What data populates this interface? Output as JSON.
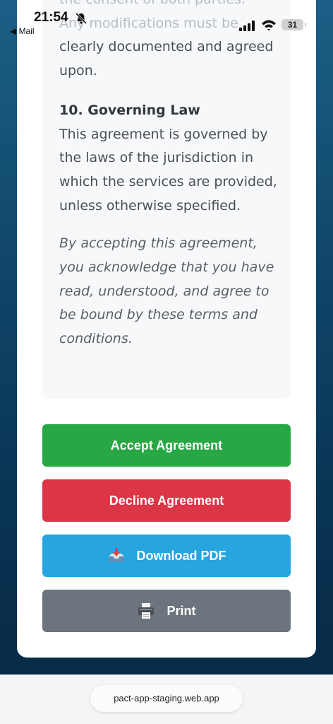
{
  "status_bar": {
    "time": "21:54",
    "back_app": "◀ Mail",
    "battery": "31"
  },
  "terms": {
    "faded_line_1": "the consent of both parties.",
    "faded_line_2": "Any modifications must be",
    "continued_text": "clearly documented and agreed upon.",
    "section_10_title": "10. Governing Law",
    "section_10_body": "This agreement is governed by the laws of the jurisdiction in which the services are provided, unless otherwise specified.",
    "closing_statement": "By accepting this agreement, you acknowledge that you have read, understood, and agree to be bound by these terms and conditions."
  },
  "buttons": {
    "accept": "Accept Agreement",
    "decline": "Decline Agreement",
    "download": "Download PDF",
    "print": "Print"
  },
  "icons": {
    "bell": "bell-slash-icon",
    "signal": "cellular-signal-icon",
    "wifi": "wifi-icon",
    "download": "inbox-tray-icon",
    "print": "printer-icon"
  },
  "colors": {
    "accept": "#28a745",
    "decline": "#dc3545",
    "download": "#26a5df",
    "print": "#6c757d"
  },
  "browser": {
    "url": "pact-app-staging.web.app"
  }
}
